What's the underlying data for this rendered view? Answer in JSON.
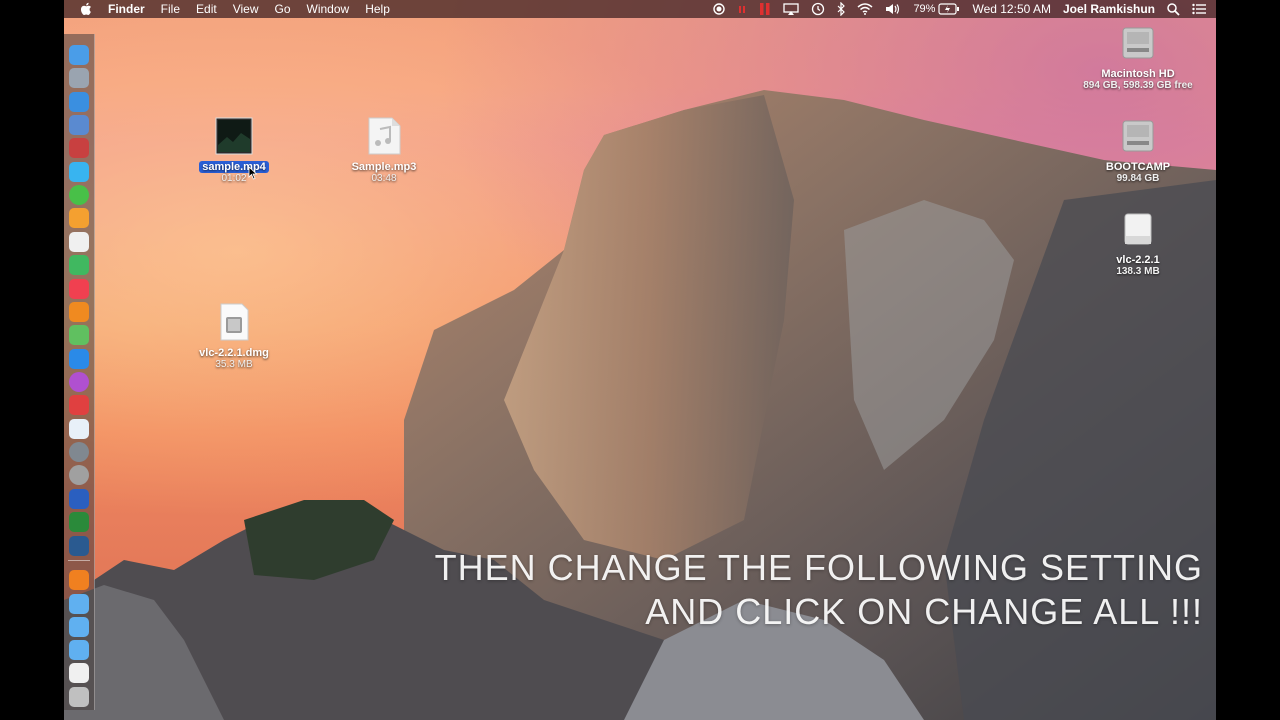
{
  "menubar": {
    "app_name": "Finder",
    "menus": [
      "File",
      "Edit",
      "View",
      "Go",
      "Window",
      "Help"
    ],
    "battery": "79%",
    "clock": "Wed 12:50 AM",
    "user": "Joel Ramkishun"
  },
  "desktop_files": [
    {
      "name": "sample.mp4",
      "detail": "01:02",
      "selected": true
    },
    {
      "name": "Sample.mp3",
      "detail": "03:48",
      "selected": false
    },
    {
      "name": "vlc-2.2.1.dmg",
      "detail": "35.3 MB",
      "selected": false
    }
  ],
  "volumes": [
    {
      "name": "Macintosh HD",
      "detail": "894 GB, 598.39 GB free"
    },
    {
      "name": "BOOTCAMP",
      "detail": "99.84 GB"
    },
    {
      "name": "vlc-2.2.1",
      "detail": "138.3 MB"
    }
  ],
  "overlay": {
    "line1": "THEN CHANGE THE FOLLOWING SETTING",
    "line2": "AND CLICK ON CHANGE ALL !!!"
  },
  "dock_icons": [
    "finder-icon",
    "launchpad-icon",
    "safari-icon",
    "preview-icon",
    "photo-booth-icon",
    "messages-icon",
    "facetime-icon",
    "photos-icon",
    "textedit-icon",
    "numbers-icon",
    "itunes-icon",
    "ibooks-icon",
    "app-icon",
    "app-store-icon",
    "itunes-store-icon",
    "chrome-icon",
    "icloud-icon",
    "system-preferences-icon",
    "boot-camp-icon",
    "word-icon",
    "excel-icon",
    "quicktime-icon",
    "vlc-icon",
    "folder-icon",
    "folder-icon",
    "folder-icon",
    "document-icon",
    "trash-icon"
  ]
}
